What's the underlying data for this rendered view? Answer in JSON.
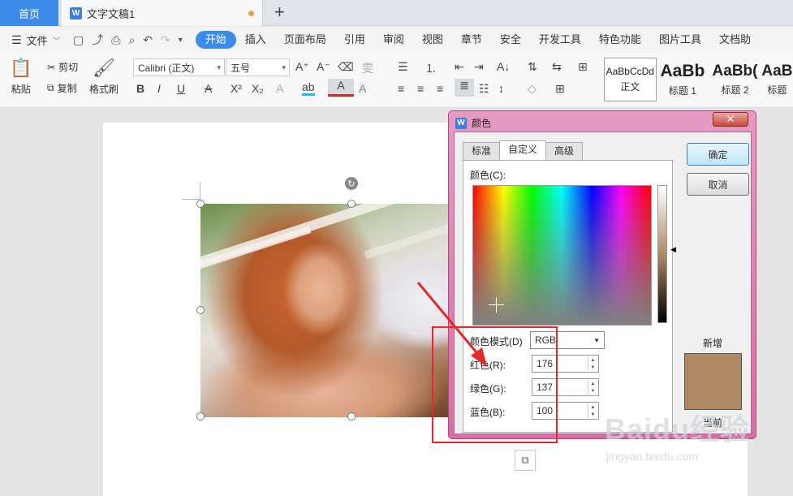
{
  "tabs": {
    "home": "首页",
    "doc_title": "文字文稿1",
    "doc_icon": "W",
    "new_tab": "+"
  },
  "menu": {
    "file": "文件",
    "items": [
      "开始",
      "插入",
      "页面布局",
      "引用",
      "审阅",
      "视图",
      "章节",
      "安全",
      "开发工具",
      "特色功能",
      "图片工具",
      "文档助"
    ],
    "active_index": 0
  },
  "ribbon": {
    "paste": "粘贴",
    "cut": "剪切",
    "copy": "复制",
    "format_painter": "格式刷",
    "font_name": "Calibri (正文)",
    "font_size": "五号",
    "styles": [
      {
        "sample": "AaBbCcDd",
        "label": "正文"
      },
      {
        "sample": "AaBb",
        "label": "标题 1"
      },
      {
        "sample": "AaBb(",
        "label": "标题 2"
      },
      {
        "sample": "AaB",
        "label": "标题"
      }
    ]
  },
  "dialog": {
    "title": "颜色",
    "tabs": [
      "标准",
      "自定义",
      "高级"
    ],
    "active_tab": 1,
    "color_label": "颜色(C):",
    "mode_label": "颜色模式(D)",
    "mode_value": "RGB",
    "red_label": "红色(R):",
    "red": "176",
    "green_label": "绿色(G):",
    "green": "137",
    "blue_label": "蓝色(B):",
    "blue": "100",
    "ok": "确定",
    "cancel": "取消",
    "new_label": "新增",
    "current_label": "当前",
    "selected_color": "#b08964"
  },
  "watermark": {
    "main": "Baidu经验",
    "sub": "jingyan.baidu.com"
  },
  "colors": {
    "accent": "#3d8be8",
    "dialog_frame": "#e08ab8",
    "annotation": "#e62828"
  }
}
